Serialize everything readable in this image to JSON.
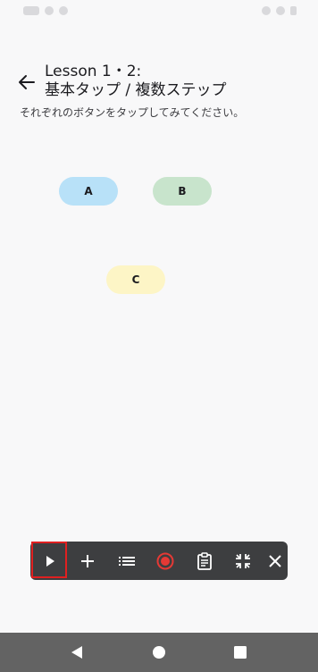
{
  "header": {
    "title_line1": "Lesson 1・2:",
    "title_line2": "基本タップ / 複数ステップ"
  },
  "instruction": "それぞれのボタンをタップしてみてください。",
  "buttons": {
    "a": {
      "label": "A",
      "color": "#b8e1f8"
    },
    "b": {
      "label": "B",
      "color": "#c8e4cc"
    },
    "c": {
      "label": "C",
      "color": "#fdf5c6"
    }
  },
  "toolbar": {
    "background": "#3d3e40",
    "items": [
      "play-icon",
      "plus-icon",
      "list-icon",
      "record-icon",
      "clipboard-icon",
      "collapse-icon",
      "close-icon"
    ],
    "highlighted": "play-icon",
    "highlight_color": "#e02020",
    "record_color": "#e53935"
  },
  "nav": {
    "items": [
      "back-icon",
      "home-icon",
      "recents-icon"
    ]
  }
}
